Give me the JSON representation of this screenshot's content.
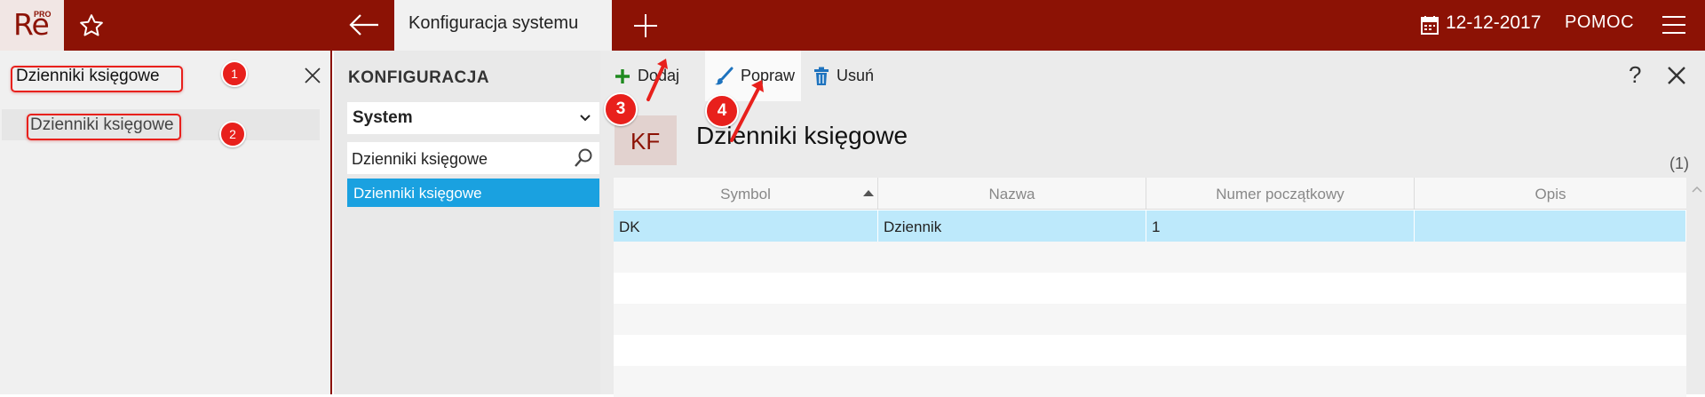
{
  "app": {
    "logo_text": "Re",
    "logo_badge": "PRO",
    "active_tab": "Konfiguracja systemu",
    "date": "12-12-2017",
    "help": "POMOC"
  },
  "search": {
    "value": "Dzienniki księgowe",
    "results": [
      {
        "label": "Dzienniki księgowe"
      }
    ]
  },
  "config": {
    "title": "KONFIGURACJA",
    "selected_group": "System",
    "filter_value": "Dzienniki księgowe",
    "items": [
      {
        "label": "Dzienniki księgowe",
        "selected": true
      }
    ]
  },
  "toolbar": {
    "add_label": "Dodaj",
    "edit_label": "Popraw",
    "delete_label": "Usuń",
    "help_label": "?"
  },
  "record": {
    "badge": "KF",
    "title": "Dzienniki księgowe",
    "count": "(1)"
  },
  "grid": {
    "columns": [
      "Symbol",
      "Nazwa",
      "Numer początkowy",
      "Opis"
    ],
    "sorted_column": "Symbol",
    "rows": [
      {
        "symbol": "DK",
        "nazwa": "Dziennik",
        "numer": "1",
        "opis": ""
      }
    ]
  },
  "markers": [
    "1",
    "2",
    "3",
    "4"
  ],
  "colors": {
    "brand": "#8c1205",
    "selection": "#1aa1e0",
    "row_selected": "#bde9fb",
    "marker": "#e8201c"
  }
}
